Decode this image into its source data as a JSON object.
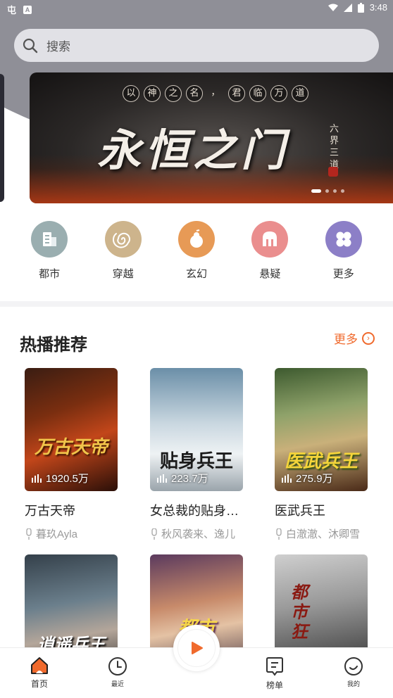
{
  "status_bar": {
    "time": "3:48"
  },
  "search": {
    "placeholder": "搜索"
  },
  "banner": {
    "tagline": [
      "以",
      "神",
      "之",
      "名",
      "，",
      "君",
      "临",
      "万",
      "道"
    ],
    "title": "永恒之门",
    "side_text": "六界三道"
  },
  "categories": [
    {
      "label": "都市",
      "icon": "building-icon",
      "color": "#9aaeb0"
    },
    {
      "label": "穿越",
      "icon": "swirl-icon",
      "color": "#cdb48c"
    },
    {
      "label": "玄幻",
      "icon": "gourd-icon",
      "color": "#e79a56"
    },
    {
      "label": "悬疑",
      "icon": "helmet-icon",
      "color": "#ea8e8e"
    },
    {
      "label": "更多",
      "icon": "clover-icon",
      "color": "#8c7fc7"
    }
  ],
  "section": {
    "title": "热播推荐",
    "more_label": "更多"
  },
  "books": [
    {
      "name": "万古天帝",
      "author": "暮玖Ayla",
      "plays": "1920.5万",
      "cover_text": "万古天帝"
    },
    {
      "name": "女总裁的贴身…",
      "author": "秋风袭来、逸儿",
      "plays": "223.7万",
      "cover_text": "贴身兵王"
    },
    {
      "name": "医武兵王",
      "author": "白澈澈、沐卿雪",
      "plays": "275.9万",
      "cover_text": "医武兵王"
    }
  ],
  "books_row2": [
    {
      "cover_text": "逍遥兵王"
    },
    {
      "cover_text": "都市"
    },
    {
      "cover_text": "都市狂"
    }
  ],
  "tabbar": {
    "home": "首页",
    "recent": "最近",
    "ranking": "榜单",
    "mine": "我的"
  },
  "colors": {
    "accent": "#f06a2d"
  }
}
